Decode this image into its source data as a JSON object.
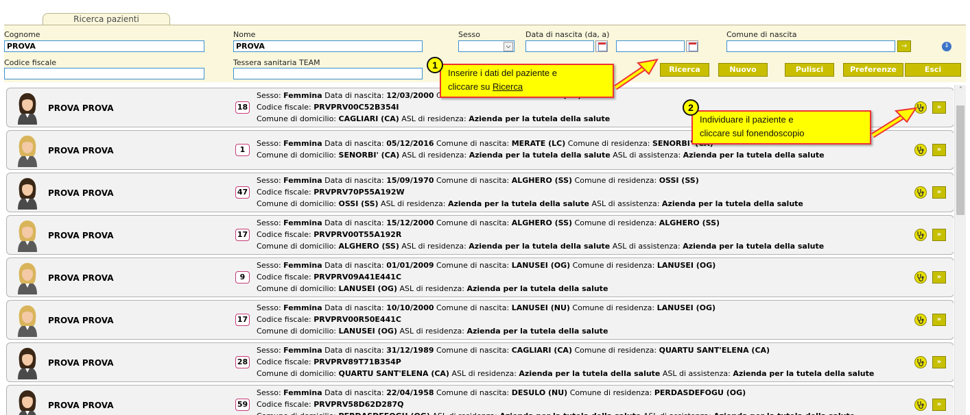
{
  "tab": {
    "label": "Ricerca pazienti"
  },
  "search": {
    "cognome_label": "Cognome",
    "cognome_value": "PROVA",
    "nome_label": "Nome",
    "nome_value": "PROVA",
    "sesso_label": "Sesso",
    "sesso_value": "",
    "data_nascita_label": "Data di nascita (da, a)",
    "data_da": "",
    "data_a": "",
    "comune_nascita_label": "Comune di nascita",
    "comune_nascita_value": "",
    "codice_fiscale_label": "Codice fiscale",
    "codice_fiscale_value": "",
    "tessera_label": "Tessera sanitaria TEAM",
    "tessera_value": ""
  },
  "buttons": {
    "ricerca": "Ricerca",
    "nuovo": "Nuovo",
    "pulisci": "Pulisci",
    "preferenze": "Preferenze",
    "esci": "Esci"
  },
  "field_labels": {
    "sesso": "Sesso:",
    "data_nascita": "Data di nascita:",
    "comune_nascita": "Comune di nascita:",
    "comune_residenza": "Comune di residenza:",
    "codice_fiscale": "Codice fiscale:",
    "comune_domicilio": "Comune di domicilio:",
    "asl_residenza": "ASL di residenza:",
    "asl_assistenza": "ASL di assistenza:"
  },
  "patients": [
    {
      "name": "PROVA PROVA",
      "age": "18",
      "sesso": "Femmina",
      "data": "12/03/2000",
      "nascita": "",
      "residenza": "CAGLIARI (CA)",
      "cf": "PRVPRV00C52B354I",
      "domicilio": "CAGLIARI (CA)",
      "asl_res": "Azienda per la tutela della salute",
      "asl_ass": "",
      "avatar": "dark"
    },
    {
      "name": "PROVA PROVA",
      "age": "1",
      "sesso": "Femmina",
      "data": "05/12/2016",
      "nascita": "MERATE (LC)",
      "residenza": "SENORBI' (CA)",
      "cf": "",
      "domicilio": "SENORBI' (CA)",
      "asl_res": "Azienda per la tutela della salute",
      "asl_ass": "Azienda per la tutela della salute",
      "avatar": "light"
    },
    {
      "name": "PROVA PROVA",
      "age": "47",
      "sesso": "Femmina",
      "data": "15/09/1970",
      "nascita": "ALGHERO (SS)",
      "residenza": "OSSI (SS)",
      "cf": "PRVPRV70P55A192W",
      "domicilio": "OSSI (SS)",
      "asl_res": "Azienda per la tutela della salute",
      "asl_ass": "Azienda per la tutela della salute",
      "avatar": "dark"
    },
    {
      "name": "PROVA PROVA",
      "age": "17",
      "sesso": "Femmina",
      "data": "15/12/2000",
      "nascita": "ALGHERO (SS)",
      "residenza": "ALGHERO (SS)",
      "cf": "PRVPRV00T55A192R",
      "domicilio": "ALGHERO (SS)",
      "asl_res": "Azienda per la tutela della salute",
      "asl_ass": "Azienda per la tutela della salute",
      "avatar": "light"
    },
    {
      "name": "PROVA PROVA",
      "age": "9",
      "sesso": "Femmina",
      "data": "01/01/2009",
      "nascita": "LANUSEI (OG)",
      "residenza": "LANUSEI (OG)",
      "cf": "PRVPRV09A41E441C",
      "domicilio": "LANUSEI (OG)",
      "asl_res": "Azienda per la tutela della salute",
      "asl_ass": "",
      "avatar": "light"
    },
    {
      "name": "PROVA PROVA",
      "age": "17",
      "sesso": "Femmina",
      "data": "10/10/2000",
      "nascita": "LANUSEI (NU)",
      "residenza": "LANUSEI (OG)",
      "cf": "PRVPRV00R50E441C",
      "domicilio": "LANUSEI (OG)",
      "asl_res": "Azienda per la tutela della salute",
      "asl_ass": "",
      "avatar": "light"
    },
    {
      "name": "PROVA PROVA",
      "age": "28",
      "sesso": "Femmina",
      "data": "31/12/1989",
      "nascita": "CAGLIARI (CA)",
      "residenza": "QUARTU SANT'ELENA (CA)",
      "cf": "PRVPRV89T71B354P",
      "domicilio": "QUARTU SANT'ELENA (CA)",
      "asl_res": "Azienda per la tutela della salute",
      "asl_ass": "Azienda per la tutela della salute",
      "avatar": "dark"
    },
    {
      "name": "PROVA PROVA",
      "age": "59",
      "sesso": "Femmina",
      "data": "22/04/1958",
      "nascita": "DESULO (NU)",
      "residenza": "PERDASDEFOGU (OG)",
      "cf": "PRVPRV58D62D287Q",
      "domicilio": "PERDASDEFOGU (OG)",
      "asl_res": "Azienda per la tutela della salute",
      "asl_ass": "Azienda per la tutela della salute",
      "avatar": "dark"
    }
  ],
  "callouts": {
    "one_number": "1",
    "one_line1": "Inserire i dati del paziente e",
    "one_line2_prefix": "cliccare su ",
    "one_line2_link": "Ricerca",
    "two_number": "2",
    "two_line1": "Individuare il paziente e",
    "two_line2": "cliccare sul fonendoscopio"
  },
  "colors": {
    "accent": "#c9bf00",
    "panel_bg": "#faf7dc",
    "callout_bg": "#ffff00",
    "callout_border": "#ee3333",
    "age_border": "#c73a77"
  }
}
